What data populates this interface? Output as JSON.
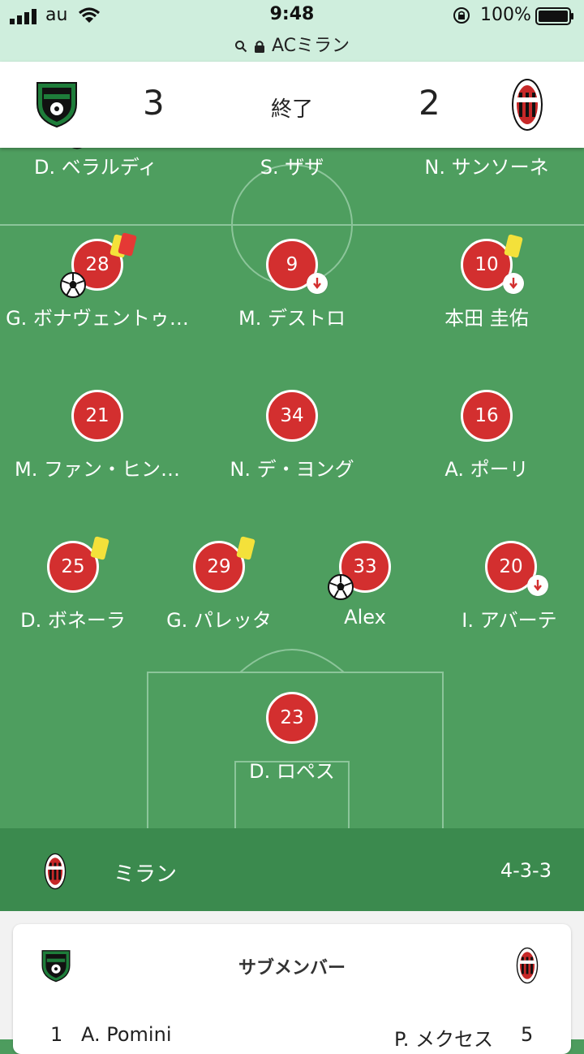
{
  "status_bar": {
    "carrier": "au",
    "time": "9:48",
    "battery": "100%",
    "url": "ACミラン"
  },
  "match": {
    "home_score": "3",
    "status": "終了",
    "away_score": "2",
    "home_crest": "sassuolo-crest-icon",
    "away_crest": "milan-crest-icon"
  },
  "opponent_row": [
    "D. ベラルディ",
    "S. ザザ",
    "N. サンソーネ"
  ],
  "forwards": [
    {
      "number": "28",
      "name": "G. ボナヴェントゥ…",
      "events": [
        "yellow-card",
        "red-card",
        "goal"
      ]
    },
    {
      "number": "9",
      "name": "M. デストロ",
      "events": [
        "sub-out"
      ]
    },
    {
      "number": "10",
      "name": "本田 圭佑",
      "events": [
        "yellow-card",
        "sub-out"
      ]
    }
  ],
  "midfielders": [
    {
      "number": "21",
      "name": "M. ファン・ヒン…"
    },
    {
      "number": "34",
      "name": "N. デ・ヨング"
    },
    {
      "number": "16",
      "name": "A. ポーリ"
    }
  ],
  "defenders": [
    {
      "number": "25",
      "name": "D. ボネーラ",
      "events": [
        "yellow-card"
      ]
    },
    {
      "number": "29",
      "name": "G. パレッタ",
      "events": [
        "yellow-card"
      ]
    },
    {
      "number": "33",
      "name": "Alex",
      "events": [
        "goal"
      ]
    },
    {
      "number": "20",
      "name": "I. アバーテ",
      "events": [
        "sub-out"
      ]
    }
  ],
  "goalkeeper": {
    "number": "23",
    "name": "D. ロペス"
  },
  "team": {
    "name": "ミラン",
    "formation": "4-3-3"
  },
  "subs": {
    "title": "サブメンバー",
    "left": {
      "number": "1",
      "name": "A. Pomini"
    },
    "right": {
      "name": "P. メクセス",
      "number": "5"
    }
  },
  "colors": {
    "pitch": "#4e9e5f",
    "team_bar": "#3b8a4e",
    "player_disc": "#d32f2f",
    "yellow_card": "#f4e13a",
    "red_card": "#e53935"
  }
}
